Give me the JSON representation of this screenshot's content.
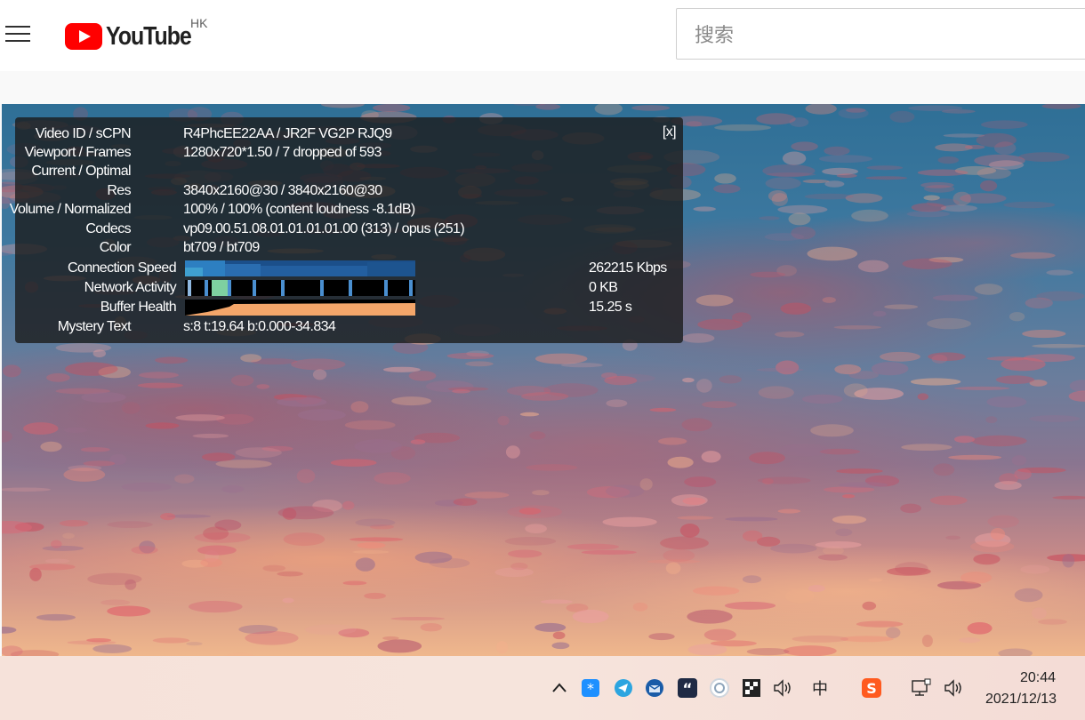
{
  "header": {
    "logo_text": "YouTube",
    "region": "HK",
    "search_placeholder": "搜索"
  },
  "stats": {
    "close_label": "[x]",
    "rows": [
      {
        "label": "Video ID / sCPN",
        "value": "R4PhcEE22AA / JR2F VG2P RJQ9"
      },
      {
        "label": "Viewport / Frames",
        "value": "1280x720*1.50 / 7 dropped of 593"
      },
      {
        "label": "Current / Optimal",
        "value": ""
      },
      {
        "label": "Res",
        "value": "3840x2160@30 / 3840x2160@30"
      },
      {
        "label": "Volume / Normalized",
        "value": "100% / 100% (content loudness -8.1dB)"
      },
      {
        "label": "Codecs",
        "value": "vp09.00.51.08.01.01.01.01.00 (313) / opus (251)"
      },
      {
        "label": "Color",
        "value": "bt709 / bt709"
      },
      {
        "label": "Connection Speed",
        "value": "262215 Kbps"
      },
      {
        "label": "Network Activity",
        "value": "0 KB"
      },
      {
        "label": "Buffer Health",
        "value": "15.25 s"
      },
      {
        "label": "Mystery Text",
        "value": "s:8 t:19.64 b:0.000-34.834"
      }
    ]
  },
  "taskbar": {
    "ime_label": "中",
    "time": "20:44",
    "date": "2021/12/13",
    "icons": [
      "chevron-up-icon",
      "star-app-icon",
      "telegram-icon",
      "thunderbird-icon",
      "quote-app-icon",
      "sync-app-icon",
      "qr-app-icon",
      "volume-icon",
      "ime-icon",
      "sogou-icon",
      "network-icon",
      "volume-icon-2"
    ]
  },
  "colors": {
    "youtube_red": "#ff0000",
    "stats_bg": "#1c1c1c",
    "conn_graph": "#1b4f8a",
    "buffer_graph": "#f4a66a"
  }
}
